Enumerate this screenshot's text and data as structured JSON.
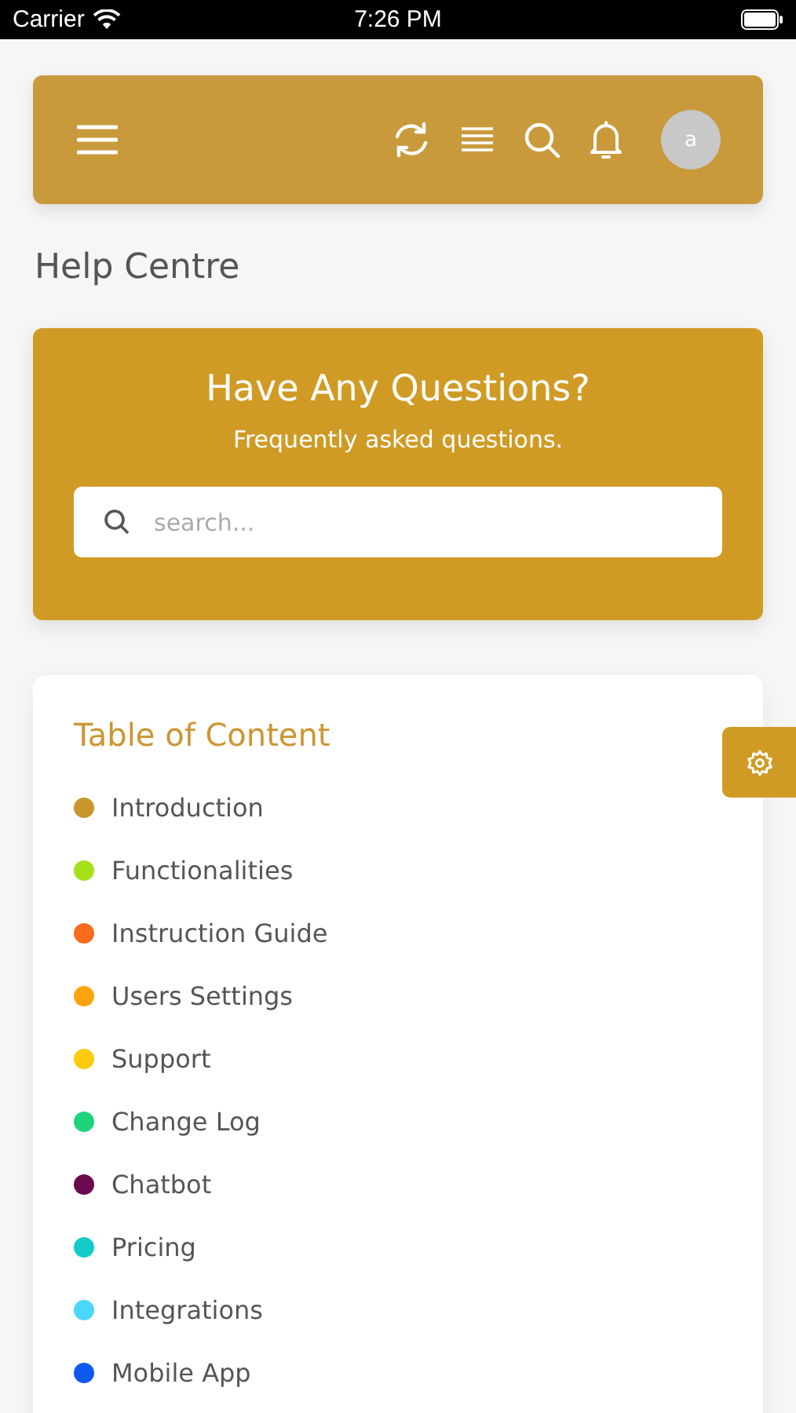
{
  "status_bar": {
    "carrier": "Carrier",
    "time": "7:26 PM"
  },
  "header": {
    "avatar": "a"
  },
  "page_title": "Help Centre",
  "hero": {
    "title": "Have Any Questions?",
    "subtitle": "Frequently asked questions.",
    "search": {
      "placeholder": "search..."
    }
  },
  "toc": {
    "title": "Table of Content",
    "items": [
      {
        "label": "Introduction",
        "color": "#c9962c"
      },
      {
        "label": "Functionalities",
        "color": "#a6e01a"
      },
      {
        "label": "Instruction Guide",
        "color": "#fb6b1c"
      },
      {
        "label": "Users Settings",
        "color": "#fea310"
      },
      {
        "label": "Support",
        "color": "#fdcb0c"
      },
      {
        "label": "Change Log",
        "color": "#1fd27c"
      },
      {
        "label": "Chatbot",
        "color": "#6b0a4f"
      },
      {
        "label": "Pricing",
        "color": "#13ccc7"
      },
      {
        "label": "Integrations",
        "color": "#4bd6fb"
      },
      {
        "label": "Mobile App",
        "color": "#0d59f0"
      }
    ]
  }
}
